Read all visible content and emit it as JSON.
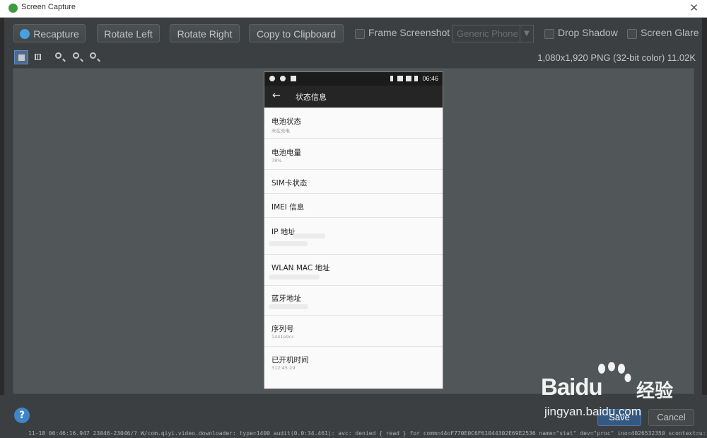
{
  "window": {
    "title": "Screen Capture",
    "close_glyph": "✕"
  },
  "toolbar": {
    "recapture_label": "Recapture",
    "rotate_left_label": "Rotate Left",
    "rotate_right_label": "Rotate Right",
    "copy_label": "Copy to Clipboard",
    "frame_label": "Frame Screenshot",
    "frame_checked": false,
    "device_value": "Generic Phone",
    "drop_shadow_label": "Drop Shadow",
    "drop_shadow_checked": false,
    "screen_glare_label": "Screen Glare",
    "screen_glare_checked": false
  },
  "image_info": "1,080x1,920 PNG (32-bit color) 11.02K",
  "phone": {
    "time": "06:46",
    "screen_title": "状态信息",
    "back_glyph": "←",
    "rows": [
      {
        "title": "电池状态",
        "subtitle": "未在充电"
      },
      {
        "title": "电池电量",
        "subtitle": "78%"
      },
      {
        "title": "SIM卡状态",
        "subtitle": ""
      },
      {
        "title": "IMEI 信息",
        "subtitle": ""
      },
      {
        "title": "IP 地址",
        "subtitle": ""
      },
      {
        "title": "WLAN MAC 地址",
        "subtitle": ""
      },
      {
        "title": "蓝牙地址",
        "subtitle": ""
      },
      {
        "title": "序列号",
        "subtitle": "1441e9cc"
      },
      {
        "title": "已开机时间",
        "subtitle": "312:45:29"
      }
    ]
  },
  "footer": {
    "help_glyph": "?",
    "save_label": "Save",
    "cancel_label": "Cancel"
  },
  "log_text": "11-18 06:46:16.947 23046-23046/? W/com.qiyi.video.downloader: type=1400 audit(0.0:34.461): avc: denied { read } for comm=44oF770E0C6F61044302E69E2536 name=\"stat\" dev=\"proc\" ino=4026532350 scontext=u:r",
  "watermark": {
    "brand": "Bai",
    "brand2": "du",
    "cn": "经验",
    "url": "jingyan.baidu.com"
  },
  "colors": {
    "accent": "#4a9fe0",
    "save": "#365880",
    "canvas": "#515658",
    "window": "#3c3f41"
  }
}
